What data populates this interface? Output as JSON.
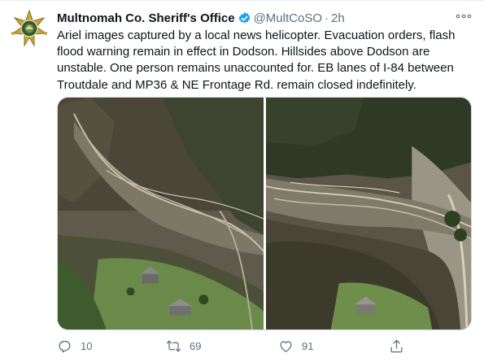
{
  "tweet": {
    "display_name": "Multnomah Co. Sheriff's Office",
    "handle": "@MultCoSO",
    "separator": "·",
    "time": "2h",
    "text": "Ariel images captured by a local news helicopter. Evacuation orders, flash flood warning remain in effect in Dodson. Hillsides above Dodson are unstable. One person remains unaccounted for. EB lanes of I-84 between Troutdale and MP36 & NE Frontage Rd. remain closed indefinitely.",
    "avatar_icon": "sheriff-star-badge-icon",
    "verified_icon": "verified-badge-icon",
    "verified_color": "#1da1f2"
  },
  "media": {
    "photos": [
      {
        "icon": "aerial-landslide-photo"
      },
      {
        "icon": "aerial-debris-flow-photo"
      }
    ]
  },
  "actions": {
    "reply_count": "10",
    "retweet_count": "69",
    "like_count": "91",
    "reply_icon": "reply-icon",
    "retweet_icon": "retweet-icon",
    "like_icon": "heart-icon",
    "share_icon": "share-icon"
  },
  "colors": {
    "text": "#0f1419",
    "secondary": "#5b7083",
    "border": "#cfd9de"
  }
}
